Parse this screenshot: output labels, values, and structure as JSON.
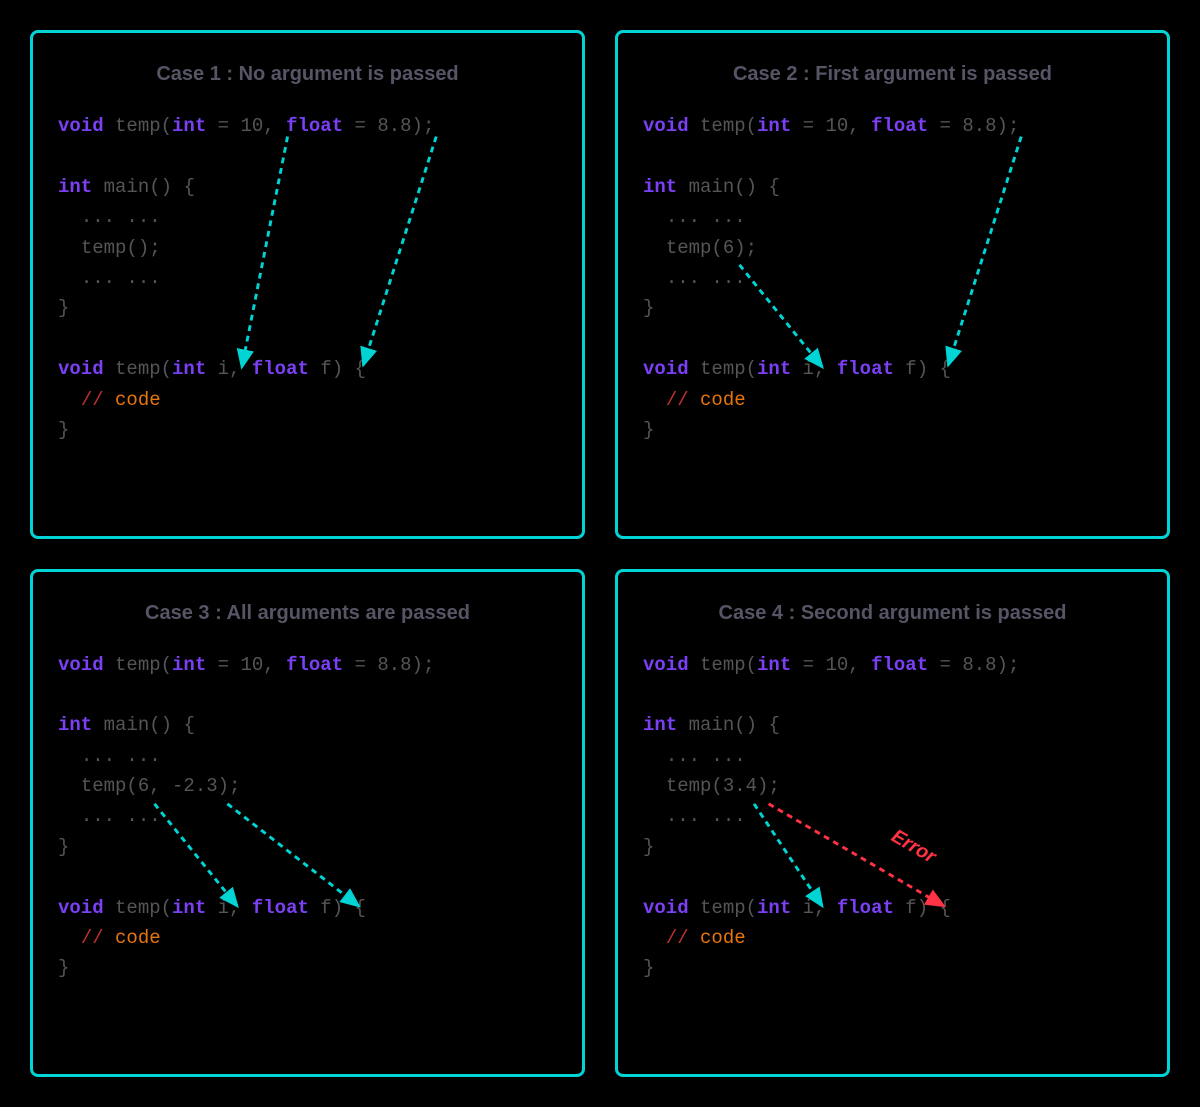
{
  "panels": [
    {
      "title": "Case 1 : No argument is passed",
      "declaration": "void temp(int = 10, float = 8.8);",
      "main_lines": [
        "int main() {",
        "  ... ...",
        "  temp();",
        "  ... ...",
        "}"
      ],
      "definition": "void temp(int i, float f) {",
      "comment": "  // code",
      "close": "}",
      "call_args": ""
    },
    {
      "title": "Case 2 : First argument is passed",
      "declaration": "void temp(int = 10, float = 8.8);",
      "main_lines": [
        "int main() {",
        "  ... ...",
        "  temp(6);",
        "  ... ...",
        "}"
      ],
      "definition": "void temp(int i, float f) {",
      "comment": "  // code",
      "close": "}",
      "call_args": "6"
    },
    {
      "title": "Case 3 : All arguments are passed",
      "declaration": "void temp(int = 10, float = 8.8);",
      "main_lines": [
        "int main() {",
        "  ... ...",
        "  temp(6, -2.3);",
        "  ... ...",
        "}"
      ],
      "definition": "void temp(int i, float f) {",
      "comment": "  // code",
      "close": "}",
      "call_args": "6, -2.3"
    },
    {
      "title": "Case 4 : Second argument is passed",
      "declaration": "void temp(int = 10, float = 8.8);",
      "main_lines": [
        "int main() {",
        "  ... ...",
        "  temp(3.4);",
        "  ... ...",
        "}"
      ],
      "definition": "void temp(int i, float f) {",
      "comment": "  // code",
      "close": "}",
      "call_args": "3.4",
      "error_label": "Error"
    }
  ],
  "code_tokens": {
    "void": "void",
    "int": "int",
    "float": "float",
    "temp": "temp",
    "main": "main",
    "ten": "10",
    "eighteight": "8.8",
    "dots": "... ...",
    "i": "i",
    "f": "f",
    "code": "code",
    "slashes": "//"
  }
}
